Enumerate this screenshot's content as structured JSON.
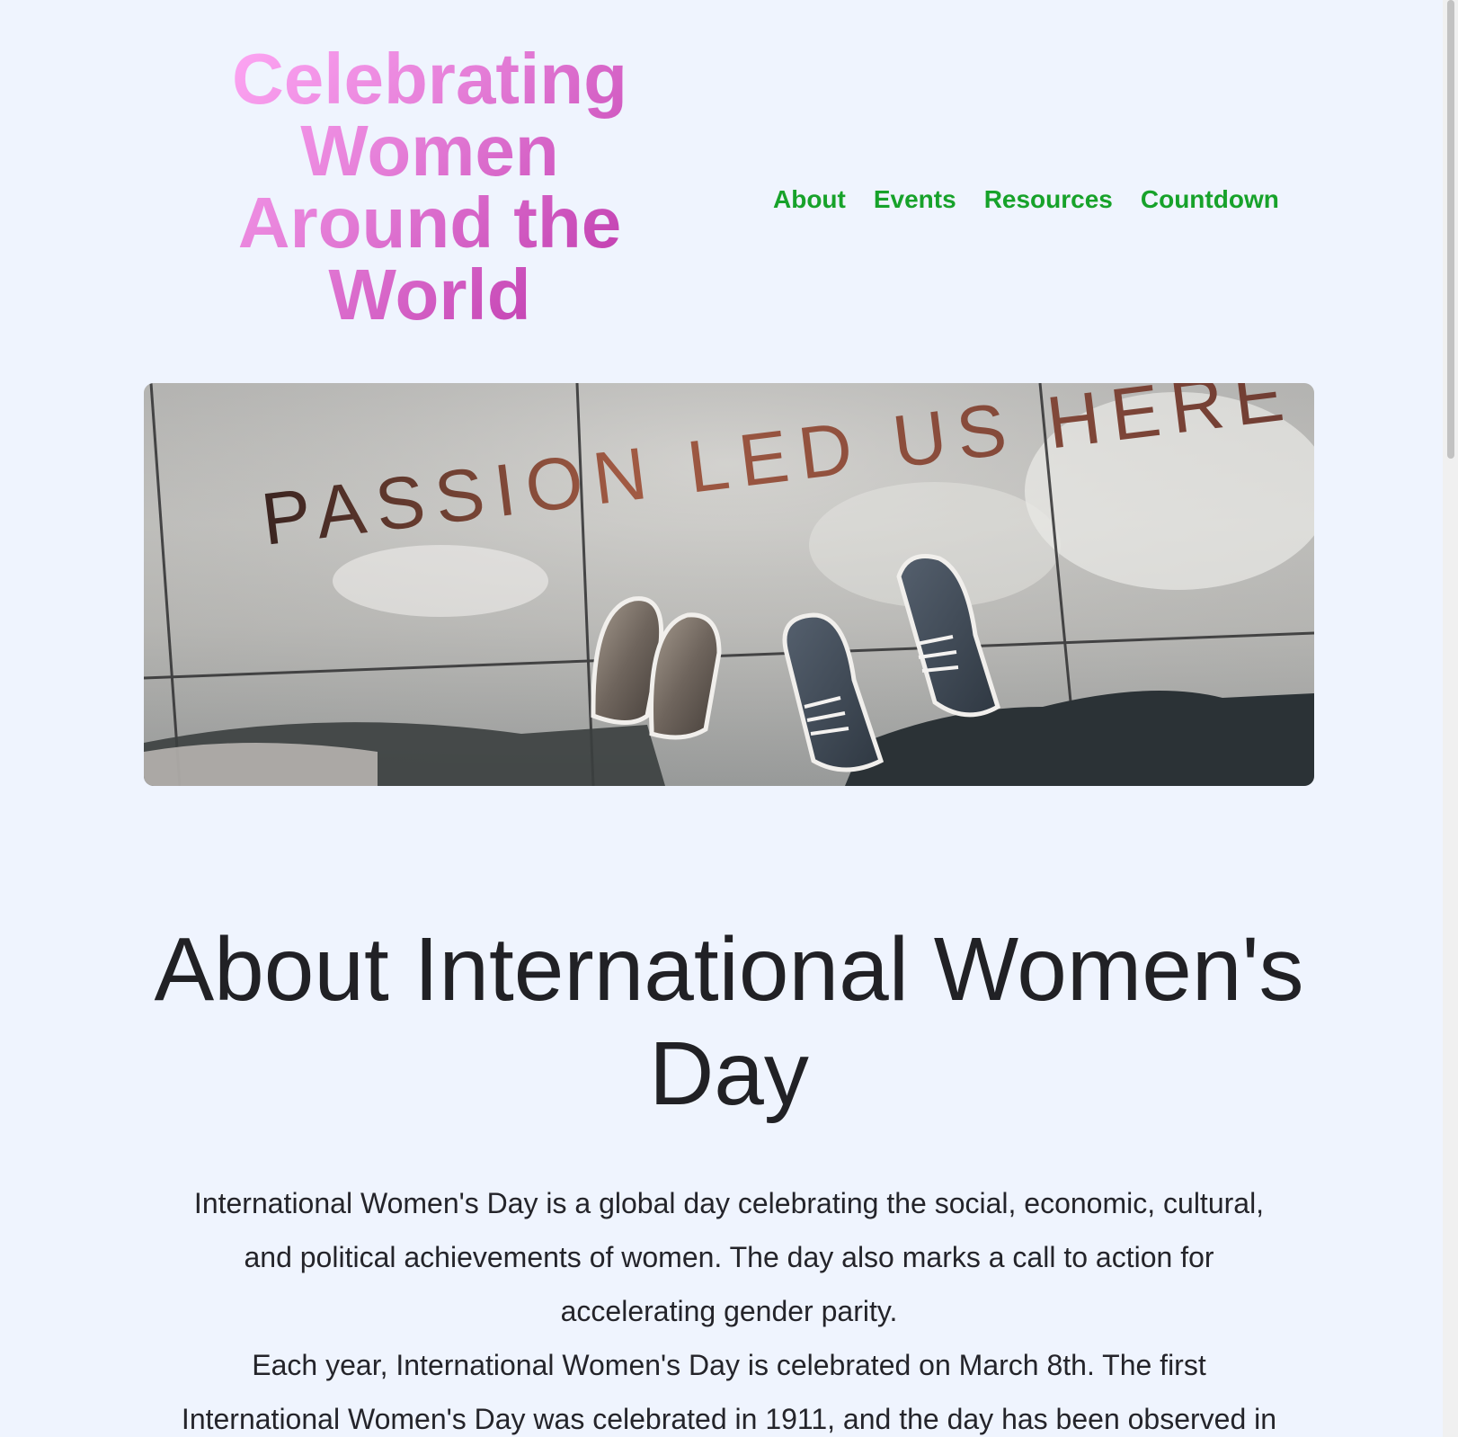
{
  "header": {
    "title": "Celebrating Women Around the World",
    "nav": [
      {
        "label": "About"
      },
      {
        "label": "Events"
      },
      {
        "label": "Resources"
      },
      {
        "label": "Countdown"
      }
    ]
  },
  "hero": {
    "image_text": "PASSION LED US HERE"
  },
  "about": {
    "heading": "About International Women's Day",
    "paragraph_1": "International Women's Day is a global day celebrating the social, economic, cultural, and political achievements of women. The day also marks a call to action for accelerating gender parity.",
    "paragraph_2": "Each year, International Women's Day is celebrated on March 8th. The first International Women's Day was celebrated in 1911, and the day has been observed in"
  },
  "colors": {
    "background": "#eff4fe",
    "nav_link": "#17a22a",
    "title_gradient_start": "#ffa9f5",
    "title_gradient_end": "#b92fa6",
    "body_text": "#24242a"
  }
}
